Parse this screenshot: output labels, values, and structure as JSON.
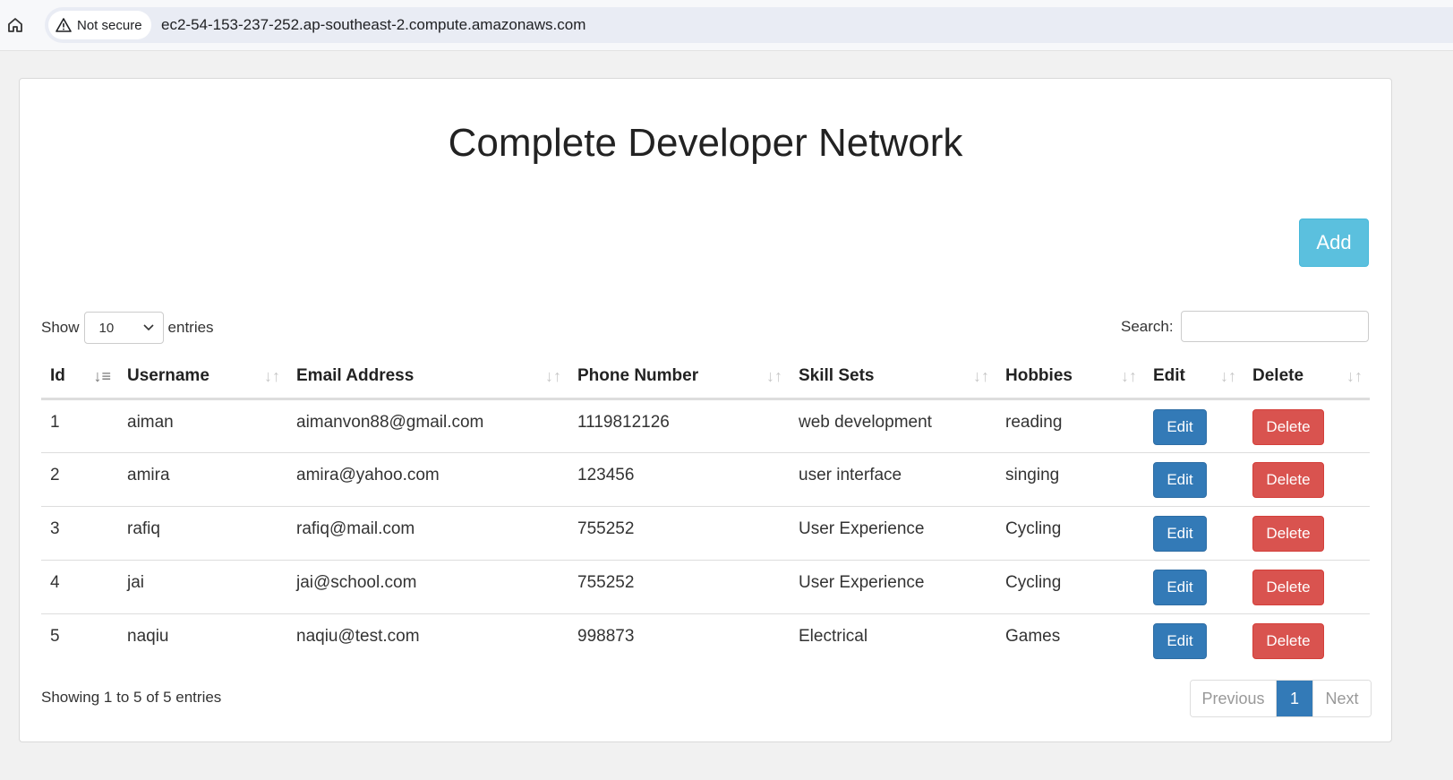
{
  "browser": {
    "security_label": "Not secure",
    "url": "ec2-54-153-237-252.ap-southeast-2.compute.amazonaws.com"
  },
  "page": {
    "title": "Complete Developer Network",
    "add_label": "Add"
  },
  "length": {
    "show_label": "Show",
    "value": "10",
    "entries_label": "entries"
  },
  "search": {
    "label": "Search:",
    "value": ""
  },
  "table": {
    "columns": [
      "Id",
      "Username",
      "Email Address",
      "Phone Number",
      "Skill Sets",
      "Hobbies",
      "Edit",
      "Delete"
    ],
    "rows": [
      {
        "id": "1",
        "username": "aiman",
        "email": "aimanvon88@gmail.com",
        "phone": "1119812126",
        "skills": "web development",
        "hobbies": "reading"
      },
      {
        "id": "2",
        "username": "amira",
        "email": "amira@yahoo.com",
        "phone": "123456",
        "skills": "user interface",
        "hobbies": "singing"
      },
      {
        "id": "3",
        "username": "rafiq",
        "email": "rafiq@mail.com",
        "phone": "755252",
        "skills": "User Experience",
        "hobbies": "Cycling"
      },
      {
        "id": "4",
        "username": "jai",
        "email": "jai@school.com",
        "phone": "755252",
        "skills": "User Experience",
        "hobbies": "Cycling"
      },
      {
        "id": "5",
        "username": "naqiu",
        "email": "naqiu@test.com",
        "phone": "998873",
        "skills": "Electrical",
        "hobbies": "Games"
      }
    ],
    "edit_label": "Edit",
    "delete_label": "Delete"
  },
  "footer": {
    "info": "Showing 1 to 5 of 5 entries",
    "previous_label": "Previous",
    "current_page": "1",
    "next_label": "Next"
  },
  "colors": {
    "info_button": "#5bc0de",
    "primary_button": "#337ab7",
    "danger_button": "#d9534f"
  }
}
